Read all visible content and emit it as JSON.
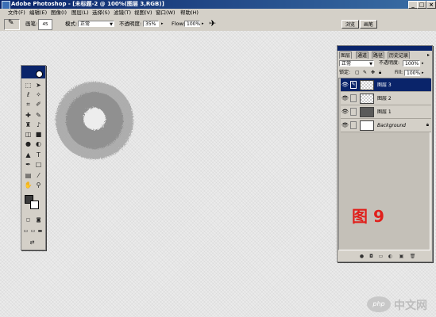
{
  "window": {
    "title": "Adobe Photoshop - [未标题-2 @ 100%(图层 3,RGB)]",
    "buttons": [
      "_",
      "□",
      "×"
    ]
  },
  "menu": {
    "items": [
      "文件(F)",
      "编辑(E)",
      "图像(I)",
      "图层(L)",
      "选择(S)",
      "滤镜(T)",
      "视图(V)",
      "窗口(W)",
      "帮助(H)"
    ]
  },
  "options": {
    "brush_label": "画笔:",
    "brush_size": "45",
    "mode_label": "模式:",
    "mode_value": "正常",
    "opacity_label": "不透明度:",
    "opacity_value": "35%",
    "flow_label": "Flow:",
    "flow_value": "100%",
    "well_tabs": [
      "浏览",
      "画笔"
    ]
  },
  "layers_panel": {
    "tabs": [
      "图层",
      "通道",
      "路径",
      "历史记录"
    ],
    "blend_mode": "正常",
    "opacity_label": "不透明度:",
    "opacity_value": "100%",
    "lock_label": "锁定:",
    "fill_label": "Fill:",
    "fill_value": "100%",
    "layers": [
      {
        "name": "图层 3",
        "selected": true
      },
      {
        "name": "图层 2",
        "selected": false
      },
      {
        "name": "图层 1",
        "selected": false
      },
      {
        "name": "Background",
        "selected": false
      }
    ]
  },
  "figure_label": "图 9",
  "watermark": {
    "icon": "php",
    "text": "中文网"
  },
  "colors": {
    "title_bar": "#0a246a",
    "panel_bg": "#d4d0c8",
    "figure_label": "#e0201c"
  }
}
